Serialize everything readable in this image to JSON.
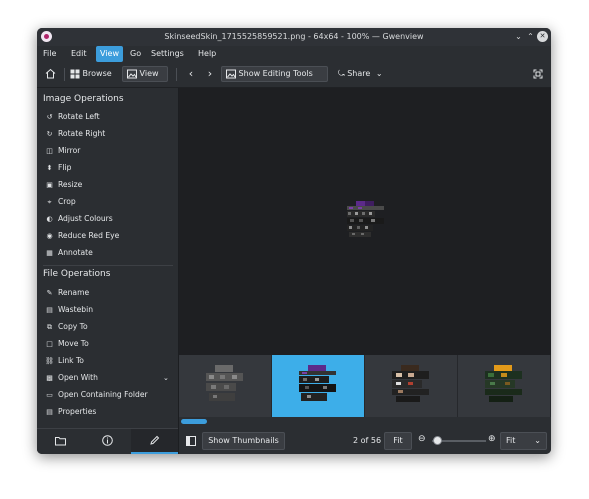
{
  "window": {
    "title": "SkinseedSkin_1715525859521.png - 64x64 - 100% — Gwenview"
  },
  "menubar": [
    "File",
    "Edit",
    "View",
    "Go",
    "Settings",
    "Help"
  ],
  "menubar_active": "View",
  "toolbar": {
    "browse_label": "Browse",
    "view_label": "View",
    "editing_tools_label": "Show Editing Tools",
    "share_label": "Share"
  },
  "sidebar": {
    "image_ops_title": "Image Operations",
    "image_ops": [
      {
        "label": "Rotate Left",
        "icon": "rotate-left-icon"
      },
      {
        "label": "Rotate Right",
        "icon": "rotate-right-icon"
      },
      {
        "label": "Mirror",
        "icon": "mirror-icon"
      },
      {
        "label": "Flip",
        "icon": "flip-icon"
      },
      {
        "label": "Resize",
        "icon": "resize-icon"
      },
      {
        "label": "Crop",
        "icon": "crop-icon"
      },
      {
        "label": "Adjust Colours",
        "icon": "adjust-colours-icon"
      },
      {
        "label": "Reduce Red Eye",
        "icon": "red-eye-icon"
      },
      {
        "label": "Annotate",
        "icon": "annotate-icon"
      }
    ],
    "file_ops_title": "File Operations",
    "file_ops": [
      {
        "label": "Rename",
        "icon": "rename-icon"
      },
      {
        "label": "Wastebin",
        "icon": "wastebin-icon"
      },
      {
        "label": "Copy To",
        "icon": "copy-to-icon"
      },
      {
        "label": "Move To",
        "icon": "move-to-icon"
      },
      {
        "label": "Link To",
        "icon": "link-to-icon"
      },
      {
        "label": "Open With",
        "icon": "open-with-icon"
      },
      {
        "label": "Open Containing Folder",
        "icon": "folder-icon"
      },
      {
        "label": "Properties",
        "icon": "properties-icon"
      }
    ]
  },
  "statusbar": {
    "thumbnails_label": "Show Thumbnails",
    "position": "2 of 56",
    "fit_button": "Fit",
    "zoom_mode": "Fit"
  },
  "colors": {
    "accent": "#3c9ddc",
    "background": "#2b2e32",
    "viewer": "#1e1f22"
  }
}
